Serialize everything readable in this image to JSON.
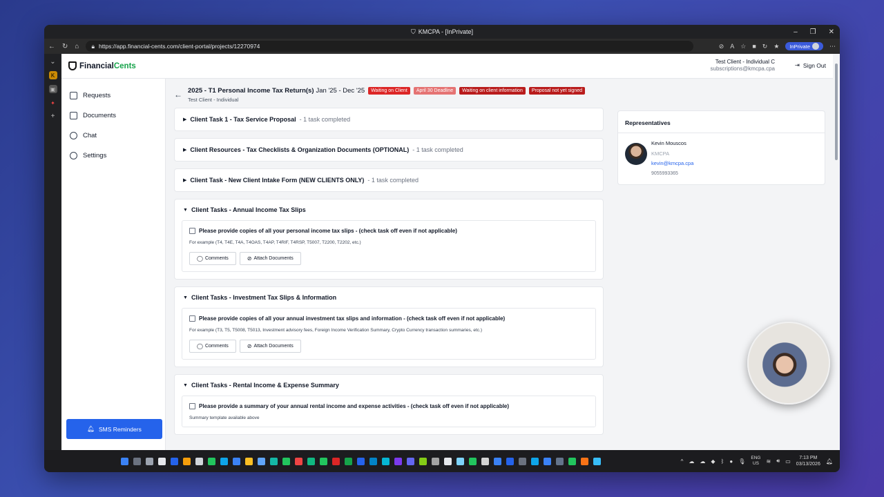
{
  "window": {
    "title": "KMCPA - [InPrivate]",
    "url": "https://app.financial-cents.com/client-portal/projects/12270974",
    "inprivate_label": "InPrivate"
  },
  "app": {
    "logo_financial": "Financial",
    "logo_cents": "Cents",
    "user_name": "Test Client - Individual C",
    "user_email": "subscriptions@kmcpa.cpa",
    "signout_label": "Sign Out"
  },
  "sidebar": {
    "items": [
      {
        "label": "Requests",
        "icon": "clipboard-icon"
      },
      {
        "label": "Documents",
        "icon": "folder-icon"
      },
      {
        "label": "Chat",
        "icon": "chat-icon"
      },
      {
        "label": "Settings",
        "icon": "gear-icon"
      }
    ],
    "sms_label": "SMS Reminders"
  },
  "project": {
    "title": "2025 - T1 Personal Income Tax Return(s)",
    "dates": "Jan '25 - Dec '25",
    "client": "Test Client - Individual",
    "badges": [
      {
        "label": "Waiting on Client",
        "color": "#dc2626"
      },
      {
        "label": "April 30 Deadline",
        "color": "#e57373"
      },
      {
        "label": "Waiting on client information",
        "color": "#b91c1c"
      },
      {
        "label": "Proposal not yet signed",
        "color": "#b91c1c"
      }
    ]
  },
  "sections": {
    "collapsed": [
      {
        "title": "Client Task 1 - Tax Service Proposal",
        "count": "- 1 task completed"
      },
      {
        "title": "Client Resources - Tax Checklists & Organization Documents (OPTIONAL)",
        "count": "- 1 task completed"
      },
      {
        "title": "Client Task - New Client Intake Form (NEW CLIENTS ONLY)",
        "count": "- 1 task completed"
      }
    ],
    "open": [
      {
        "title": "Client Tasks - Annual Income Tax Slips",
        "task": "Please provide copies of all your personal income tax slips - (check task off even if not applicable)",
        "desc": "For example (T4, T4E, T4A, T4OAS, T4AP, T4RIF, T4RSP, T5007, T2200, T2202, etc.)"
      },
      {
        "title": "Client Tasks - Investment Tax Slips & Information",
        "task": "Please provide copies of all your annual investment tax slips and information - (check task off even if not applicable)",
        "desc": "For example (T3, T5, T5008, T5013, Investment advisory fees, Foreign Income Verification Summary, Crypto Currency transaction summaries, etc.)"
      },
      {
        "title": "Client Tasks - Rental Income & Expense Summary",
        "task": "Please provide a summary of your annual rental income and expense activities - (check task off even if not applicable)",
        "desc": "Summary template available above"
      }
    ],
    "comments_label": "Comments",
    "attach_label": "Attach Documents"
  },
  "representatives": {
    "heading": "Representatives",
    "name": "Kevin Mouscos",
    "company": "KMCPA",
    "email": "kevin@kmcpa.cpa",
    "phone": "9055993365"
  },
  "taskbar": {
    "lang_top": "ENG",
    "lang_bottom": "US",
    "time": "7:13 PM",
    "date": "03/13/2026"
  }
}
